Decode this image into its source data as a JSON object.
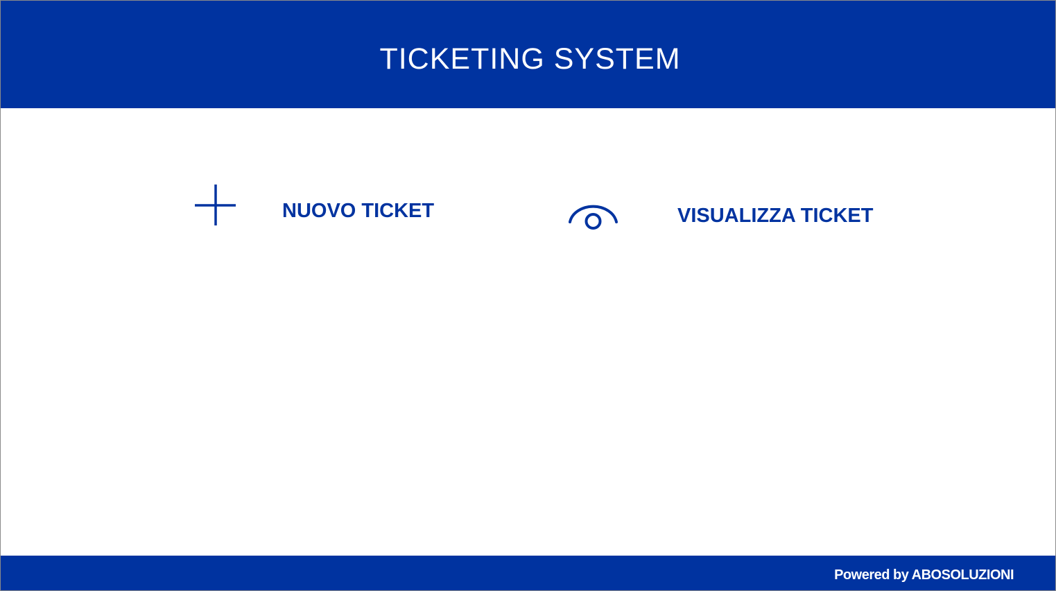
{
  "header": {
    "title": "TICKETING SYSTEM"
  },
  "actions": {
    "new_ticket": {
      "label": "NUOVO TICKET",
      "icon": "plus-icon"
    },
    "view_ticket": {
      "label": "VISUALIZZA TICKET",
      "icon": "eye-icon"
    }
  },
  "footer": {
    "text": "Powered by ABOSOLUZIONI"
  },
  "colors": {
    "brand": "#0033a0",
    "background": "#ffffff",
    "text_on_brand": "#ffffff"
  }
}
